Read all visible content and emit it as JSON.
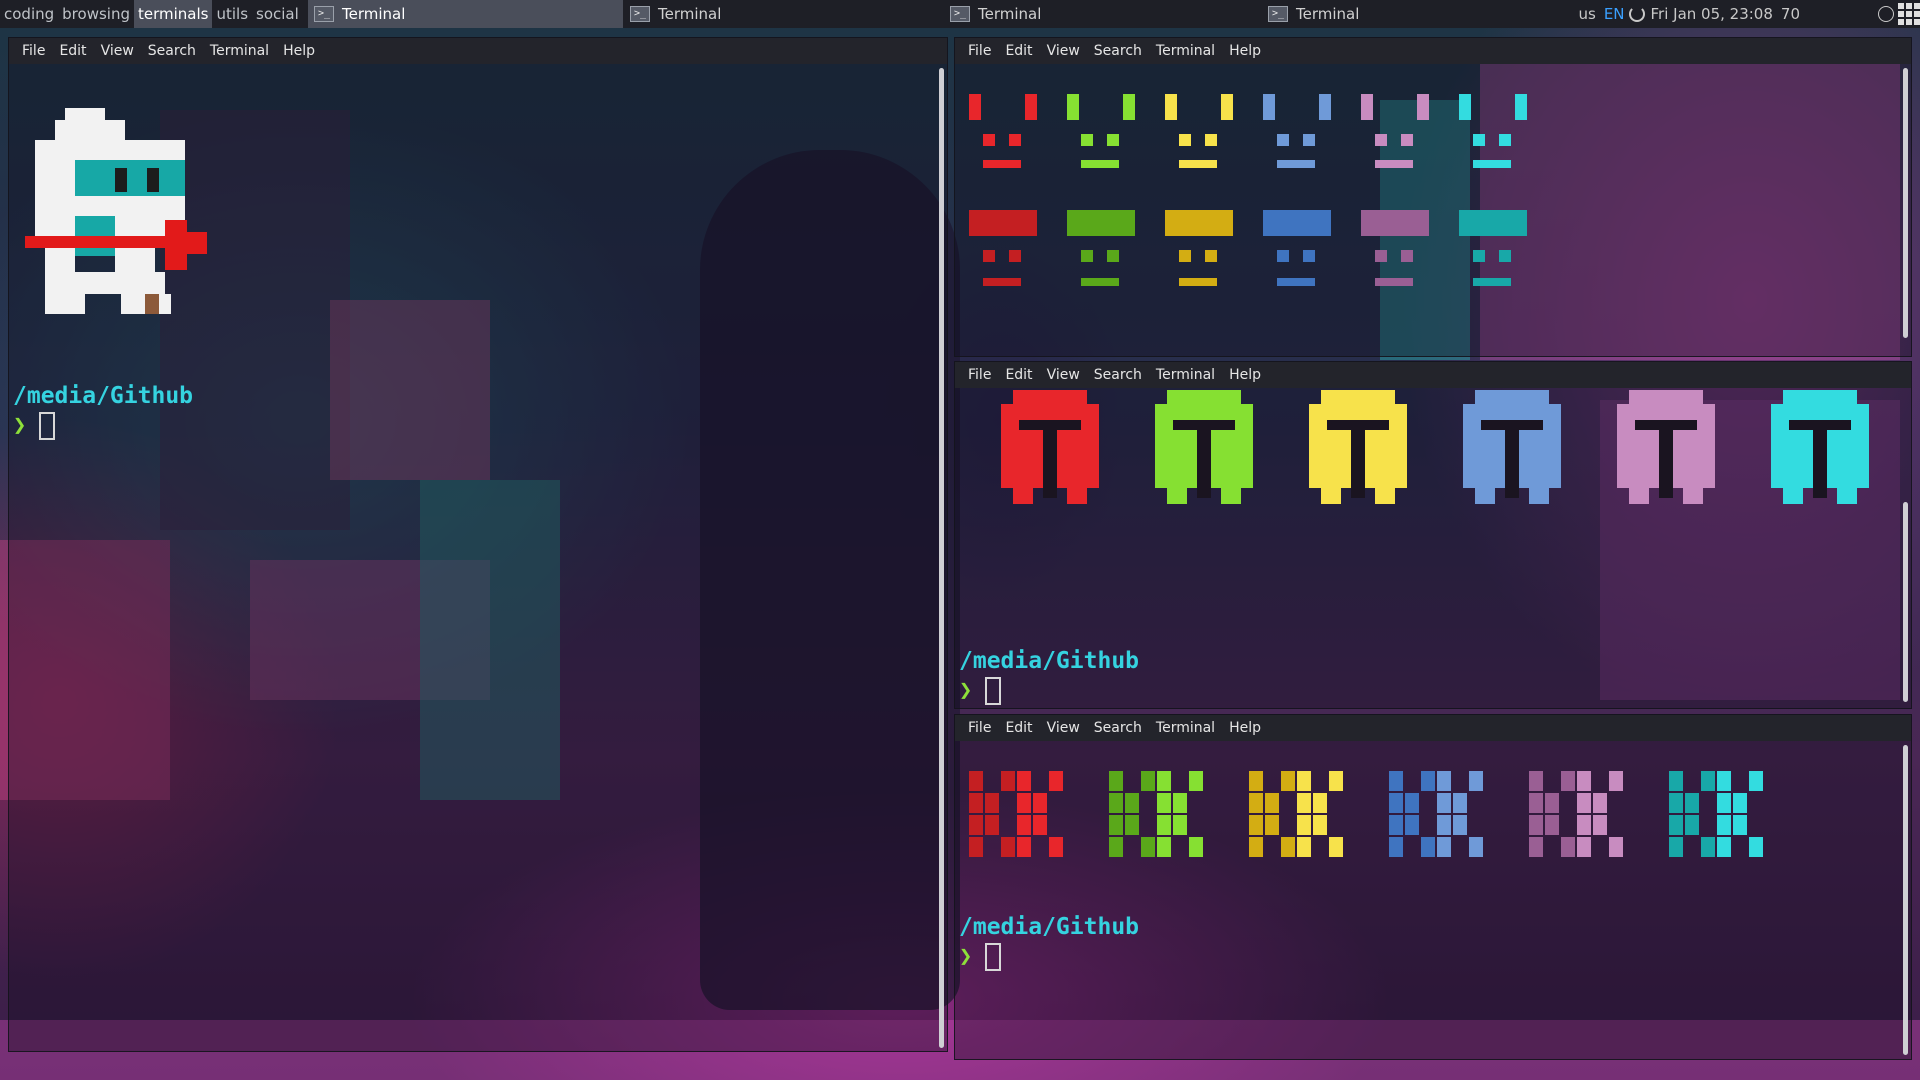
{
  "top_panel": {
    "workspaces": [
      "coding",
      "browsing",
      "terminals",
      "utils",
      "social"
    ],
    "active_workspace": "terminals",
    "tasks": [
      {
        "title": "Terminal",
        "active": true
      },
      {
        "title": "Terminal",
        "active": false
      },
      {
        "title": "Terminal",
        "active": false
      },
      {
        "title": "Terminal",
        "active": false
      }
    ],
    "tray": {
      "keyboard_layout": "us",
      "language": "EN",
      "clock": "Fri Jan 05, 23:08",
      "volume": "70"
    }
  },
  "terminal_menu": [
    "File",
    "Edit",
    "View",
    "Search",
    "Terminal",
    "Help"
  ],
  "terminals": {
    "left": {
      "cwd": "/media/Github",
      "prompt_symbol": "❯"
    },
    "right_middle": {
      "cwd": "/media/Github",
      "prompt_symbol": "❯"
    },
    "right_bottom": {
      "cwd": "/media/Github",
      "prompt_symbol": "❯"
    }
  },
  "ascii_art": {
    "space_invaders_row1": "-@=",
    "palette": {
      "red": "#e8262b",
      "green": "#86e032",
      "yellow": "#f7e24b",
      "blue": "#6f9ad8",
      "pink": "#c88cc0",
      "cyan": "#33dce0",
      "red_dark": "#c41f22",
      "green_dark": "#5aa81a",
      "yellow_dark": "#d3ad13",
      "blue_dark": "#3f74c0",
      "pink_dark": "#9a5f94",
      "cyan_dark": "#18a8a8"
    }
  },
  "colors": {
    "panel_bg": "#1e1f26",
    "active_tab": "#4a4e5a",
    "prompt_path": "#35d3e0",
    "prompt_arrow": "#8ee03a"
  }
}
